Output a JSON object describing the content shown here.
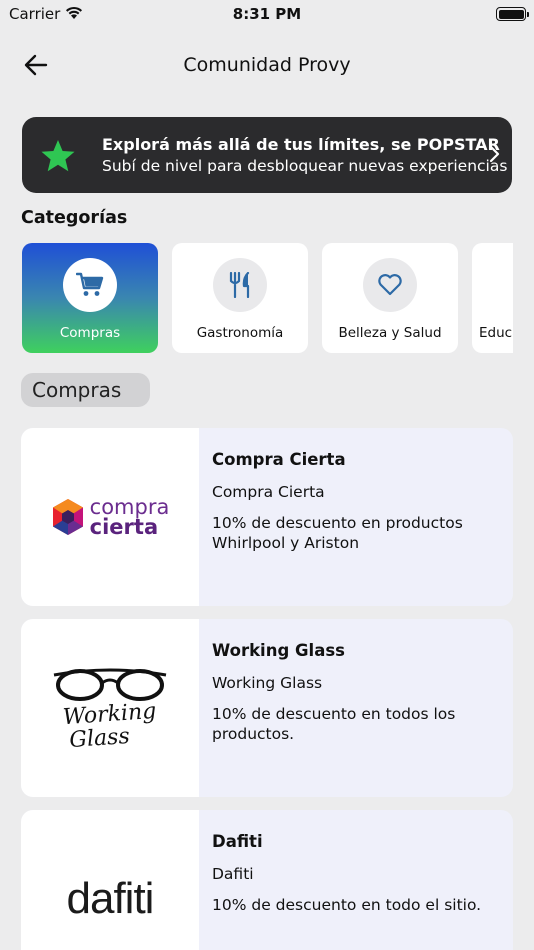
{
  "status_bar": {
    "carrier": "Carrier",
    "time": "8:31 PM"
  },
  "nav": {
    "title": "Comunidad Provy"
  },
  "banner": {
    "title": "Explorá más allá de tus límites, se POPSTAR",
    "subtitle": "Subí de nivel para desbloquear nuevas experiencias"
  },
  "categories_section": {
    "title": "Categorías",
    "items": [
      {
        "label": "Compras",
        "icon": "shopping-cart-icon",
        "selected": true
      },
      {
        "label": "Gastronomía",
        "icon": "fork-knife-icon",
        "selected": false
      },
      {
        "label": "Belleza y Salud",
        "icon": "heart-icon",
        "selected": false
      },
      {
        "label": "Educación",
        "icon": "education-icon",
        "selected": false
      }
    ]
  },
  "selected_category": "Compras",
  "offers": [
    {
      "name": "Compra Cierta",
      "subtitle": "Compra Cierta",
      "description": "10% de descuento en productos Whirlpool y Ariston",
      "logo_text": [
        "compra",
        "cierta"
      ]
    },
    {
      "name": "Working Glass",
      "subtitle": "Working Glass",
      "description": "10% de descuento en todos los productos.",
      "logo_text": [
        "Working",
        "Glass"
      ]
    },
    {
      "name": "Dafiti",
      "subtitle": "Dafiti",
      "description": "10% de descuento en todo el sitio.",
      "logo_text": [
        "dafiti"
      ]
    }
  ],
  "colors": {
    "background": "#ececed",
    "banner": "#2b2b2d",
    "star": "#2fc653",
    "card_body": "#eff0fa",
    "active_gradient_top": "#1f4fd6",
    "active_gradient_bottom": "#3fd05e",
    "cat_icon": "#2d6aa6"
  }
}
